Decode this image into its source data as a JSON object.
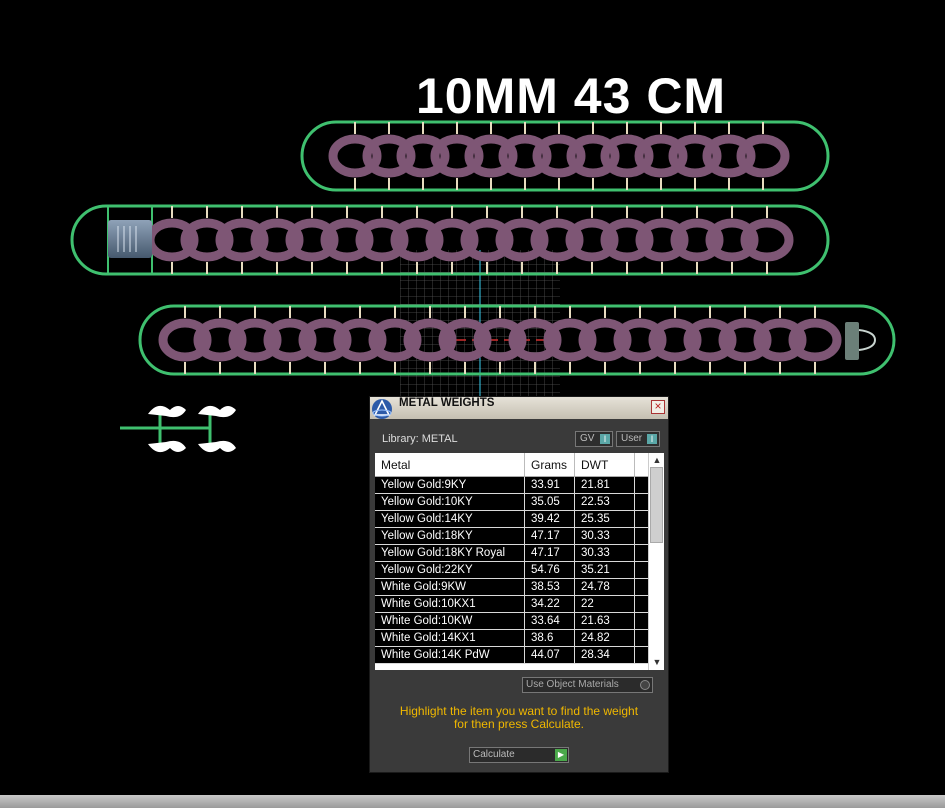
{
  "canvas": {
    "title": "10MM 43 CM",
    "colors": {
      "background": "#000000",
      "rail": "#3fc06f",
      "chain_link": "#7e5675",
      "grid": "#6a6a6a",
      "accent": "#3ad0f0"
    }
  },
  "dialog": {
    "title": "METAL WEIGHTS",
    "close_icon": "close-icon",
    "library_label": "Library: METAL",
    "toggle_gv": "GV",
    "toggle_user": "User",
    "toggle_indicator": "I",
    "columns": [
      "Metal",
      "Grams",
      "DWT"
    ],
    "rows": [
      [
        "Yellow Gold:9KY",
        "33.91",
        "21.81"
      ],
      [
        "Yellow Gold:10KY",
        "35.05",
        "22.53"
      ],
      [
        "Yellow Gold:14KY",
        "39.42",
        "25.35"
      ],
      [
        "Yellow Gold:18KY",
        "47.17",
        "30.33"
      ],
      [
        "Yellow Gold:18KY Royal",
        "47.17",
        "30.33"
      ],
      [
        "Yellow Gold:22KY",
        "54.76",
        "35.21"
      ],
      [
        "White Gold:9KW",
        "38.53",
        "24.78"
      ],
      [
        "White Gold:10KX1",
        "34.22",
        "22"
      ],
      [
        "White Gold:10KW",
        "33.64",
        "21.63"
      ],
      [
        "White Gold:14KX1",
        "38.6",
        "24.82"
      ],
      [
        "White Gold:14K PdW",
        "44.07",
        "28.34"
      ]
    ],
    "use_object_materials": "Use Object Materials",
    "instruction_line1": "Highlight the item you want to find the weight",
    "instruction_line2": "for then press Calculate.",
    "calculate_label": "Calculate",
    "instruction_color": "#f0b800"
  }
}
